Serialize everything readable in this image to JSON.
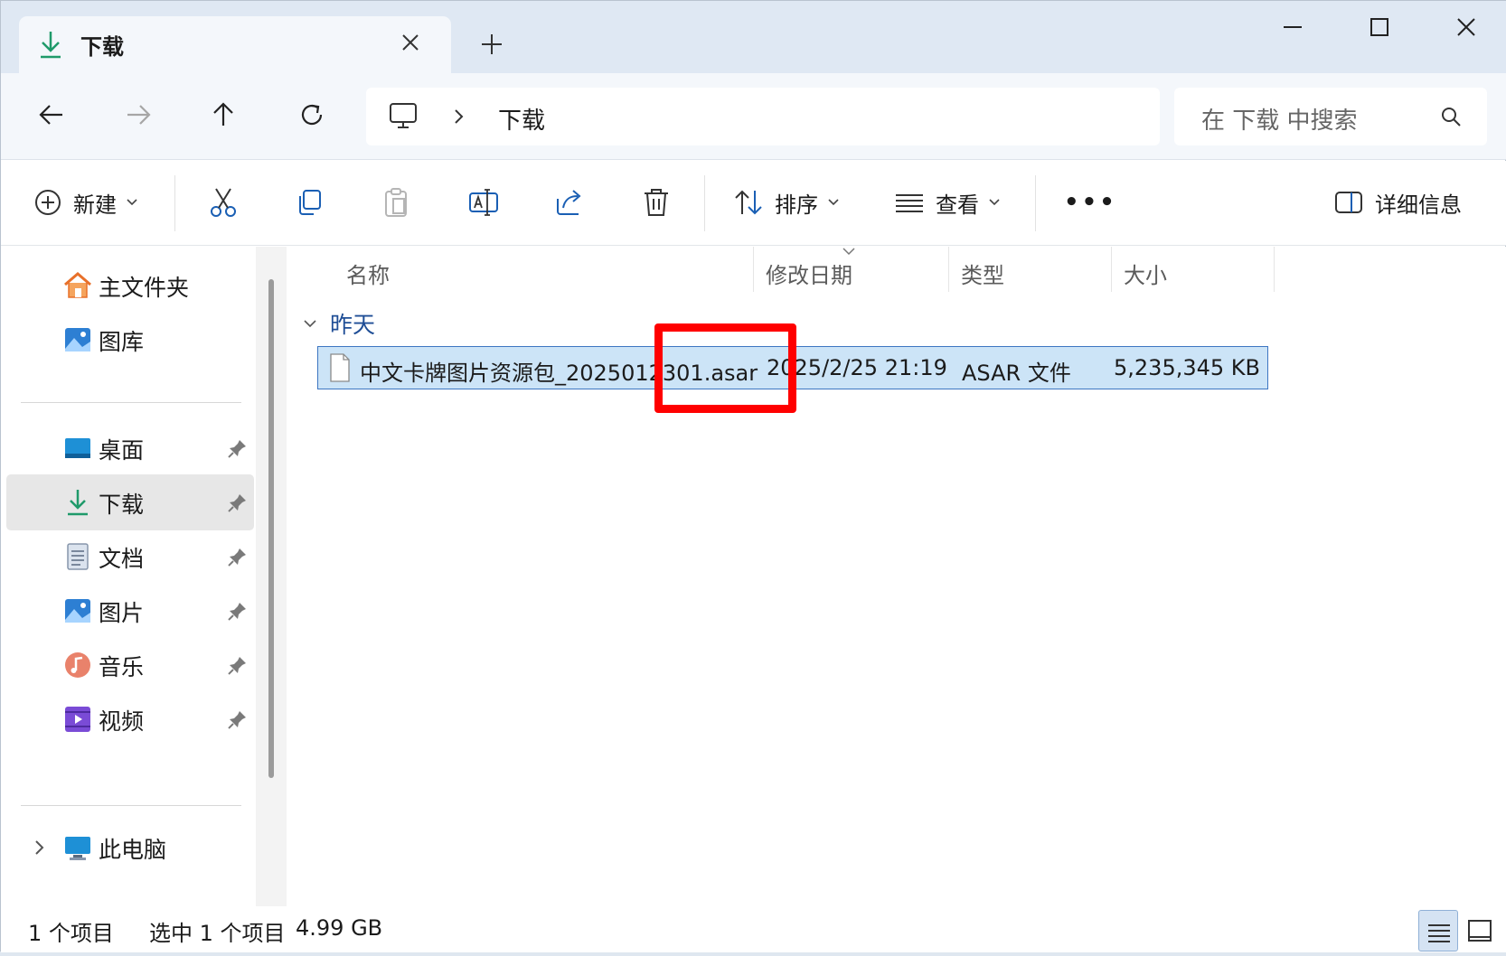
{
  "tab": {
    "title": "下载",
    "icon": "download-icon"
  },
  "address": {
    "current": "下载",
    "root_icon": "computer-icon"
  },
  "search": {
    "placeholder": "在 下载 中搜索"
  },
  "commands": {
    "new": "新建",
    "sort": "排序",
    "view": "查看",
    "more": "•••",
    "details": "详细信息"
  },
  "sidebar": {
    "home": "主文件夹",
    "gallery": "图库",
    "pinned": [
      {
        "label": "桌面",
        "icon": "desktop-icon"
      },
      {
        "label": "下载",
        "icon": "download-icon"
      },
      {
        "label": "文档",
        "icon": "documents-icon"
      },
      {
        "label": "图片",
        "icon": "pictures-icon"
      },
      {
        "label": "音乐",
        "icon": "music-icon"
      },
      {
        "label": "视频",
        "icon": "videos-icon"
      }
    ],
    "this_pc": "此电脑",
    "selected": "下载"
  },
  "columns": {
    "name": "名称",
    "modified": "修改日期",
    "type": "类型",
    "size": "大小"
  },
  "group": {
    "label": "昨天"
  },
  "files": [
    {
      "name": "中文卡牌图片资源包_2025012301.asar",
      "modified": "2025/2/25 21:19",
      "type": "ASAR 文件",
      "size": "5,235,345 KB"
    }
  ],
  "status": {
    "count": "1 个项目",
    "selected": "选中 1 个项目",
    "size": "4.99 GB"
  },
  "colors": {
    "accent": "#0067c0",
    "selection": "#cce4f7",
    "highlight": "#ff0000"
  }
}
